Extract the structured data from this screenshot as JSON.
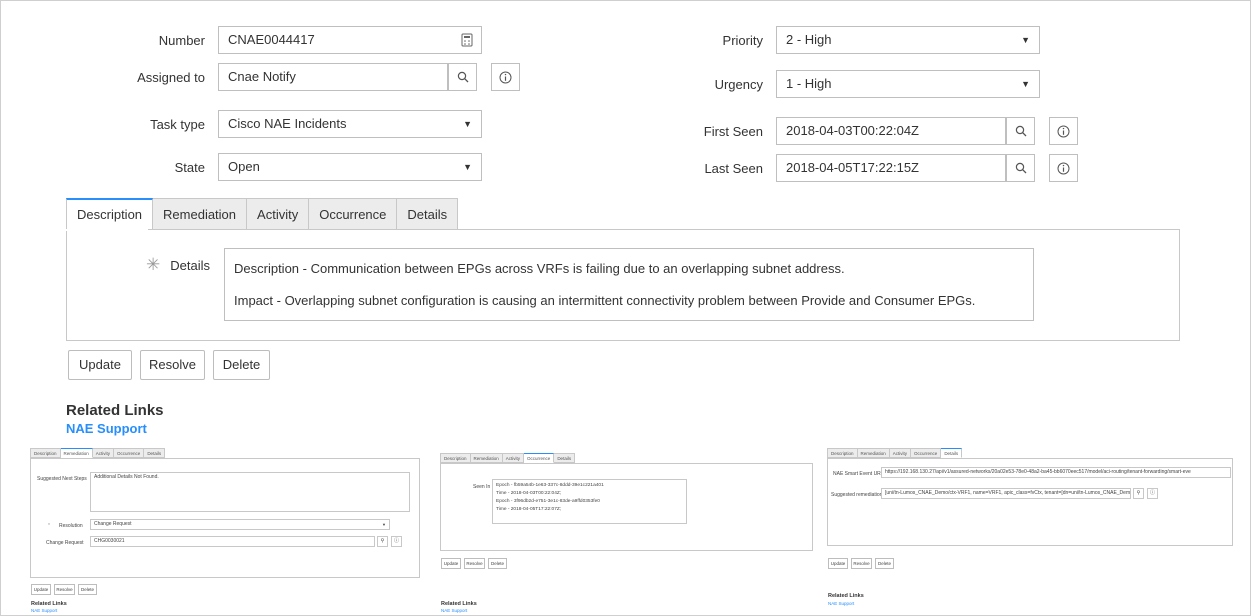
{
  "form": {
    "number": {
      "label": "Number",
      "value": "CNAE0044417"
    },
    "assigned_to": {
      "label": "Assigned to",
      "value": "Cnae Notify"
    },
    "task_type": {
      "label": "Task type",
      "value": "Cisco NAE Incidents"
    },
    "state": {
      "label": "State",
      "value": "Open"
    },
    "priority": {
      "label": "Priority",
      "value": "2 - High"
    },
    "urgency": {
      "label": "Urgency",
      "value": "1 - High"
    },
    "first_seen": {
      "label": "First Seen",
      "value": "2018-04-03T00:22:04Z"
    },
    "last_seen": {
      "label": "Last Seen",
      "value": "2018-04-05T17:22:15Z"
    }
  },
  "tabs": [
    "Description",
    "Remediation",
    "Activity",
    "Occurrence",
    "Details"
  ],
  "details": {
    "label": "Details",
    "line1": "Description - Communication between EPGs across VRFs is failing due to an overlapping subnet address.",
    "line2": "Impact - Overlapping subnet configuration is causing an intermittent connectivity problem between Provide and Consumer EPGs."
  },
  "buttons": {
    "update": "Update",
    "resolve": "Resolve",
    "delete": "Delete"
  },
  "related": {
    "title": "Related Links",
    "link": "NAE Support"
  },
  "thumb1": {
    "next_steps_label": "Suggested Next Steps",
    "next_steps_value": "Additional Details Not Found.",
    "resolution_label": "Resolution",
    "resolution_value": "Change Request",
    "change_request_label": "Change Request",
    "change_request_value": "CHG0030021"
  },
  "thumb2": {
    "seen_in_label": "Seen In",
    "lines": [
      "Epoch - fb59a54b-1e63-337c-8ddd-39e1c221a401",
      "Time - 2018-04-03T00:22:04Z;",
      "Epoch - 3f96db2d-e751-3e1c-83de-a9ffd0353fe0",
      "Time - 2018-04-05T17:22:07Z;"
    ]
  },
  "thumb3": {
    "url_label": "NAE Smart Event URL",
    "url_value": "https://192.168.130.27/api/v1/assured-networks/20a02e53-78e0-48a2-ba45-bb6070eec517/model/aci-routing/tenant-forwarding/smart-eve",
    "remediation_label": "Suggested remediation",
    "remediation_value": "[uni/tn-Lumos_CNAE_Demo/ctx-VRF1, name=VRF1, apic_class=fvCtx, tenant=[dn=uni/tn-Lumos_CNAE_Demo, name=Lumos_"
  },
  "colors": {
    "accent": "#278efc",
    "tab_inactive": "#ececec",
    "border": "#c8c8c8"
  }
}
